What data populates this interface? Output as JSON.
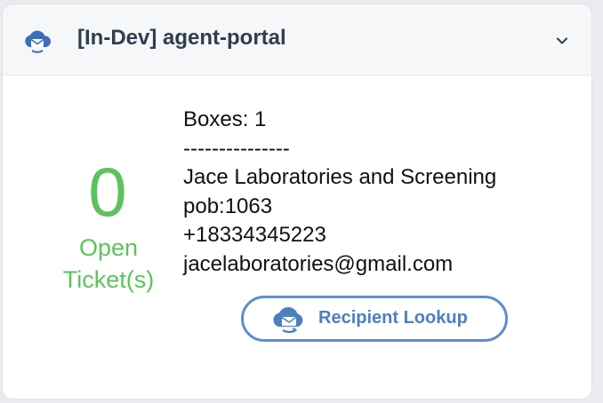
{
  "header": {
    "title": "[In-Dev] agent-portal",
    "icon": "cloud-agent-icon",
    "toggle_icon": "chevron-down-icon"
  },
  "tickets": {
    "count": "0",
    "label_line1": "Open",
    "label_line2": "Ticket(s)"
  },
  "recipient": {
    "boxes": "Boxes: 1",
    "divider": "---------------",
    "name": "Jace Laboratories and Screening",
    "pob": "pob:1063",
    "phone": "+18334345223",
    "email": "jacelaboratories@gmail.com"
  },
  "lookup_button": {
    "label": "Recipient Lookup",
    "icon": "cloud-lookup-icon"
  },
  "colors": {
    "accent_green": "#5cc35c",
    "accent_blue": "#4d7fc0",
    "header_text": "#2f3d52"
  }
}
